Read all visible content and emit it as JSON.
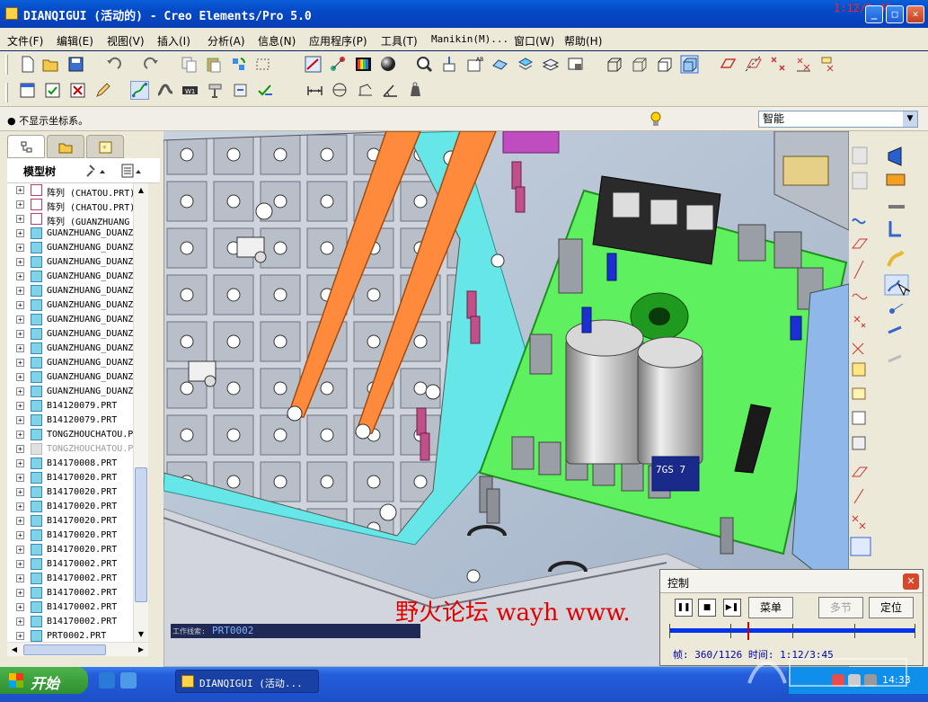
{
  "window": {
    "title": "DIANQIGUI (活动的) - Creo Elements/Pro 5.0",
    "timecode": "1:12/3:45"
  },
  "menu": [
    "文件(F)",
    "编辑(E)",
    "视图(V)",
    "插入(I)",
    "分析(A)",
    "信息(N)",
    "应用程序(P)",
    "工具(T)",
    "Manikin(M)...",
    "窗口(W)",
    "帮助(H)"
  ],
  "status": {
    "message": "● 不显示坐标系。",
    "filter_value": "智能"
  },
  "model_tree": {
    "title": "模型树",
    "items": [
      {
        "label": "阵列 (CHATOU.PRT)",
        "kind": "pattern"
      },
      {
        "label": "阵列 (CHATOU.PRT)",
        "kind": "pattern"
      },
      {
        "label": "阵列 (GUANZHUANG_",
        "kind": "pattern"
      },
      {
        "label": "GUANZHUANG_DUANZ",
        "kind": "part"
      },
      {
        "label": "GUANZHUANG_DUANZ",
        "kind": "part"
      },
      {
        "label": "GUANZHUANG_DUANZ",
        "kind": "part"
      },
      {
        "label": "GUANZHUANG_DUANZ",
        "kind": "part"
      },
      {
        "label": "GUANZHUANG_DUANZ",
        "kind": "part"
      },
      {
        "label": "GUANZHUANG_DUANZ",
        "kind": "part"
      },
      {
        "label": "GUANZHUANG_DUANZ",
        "kind": "part"
      },
      {
        "label": "GUANZHUANG_DUANZ",
        "kind": "part"
      },
      {
        "label": "GUANZHUANG_DUANZ",
        "kind": "part"
      },
      {
        "label": "GUANZHUANG_DUANZ",
        "kind": "part"
      },
      {
        "label": "GUANZHUANG_DUANZ",
        "kind": "part"
      },
      {
        "label": "GUANZHUANG_DUANZ",
        "kind": "part"
      },
      {
        "label": "B14120079.PRT",
        "kind": "part"
      },
      {
        "label": "B14120079.PRT",
        "kind": "part"
      },
      {
        "label": "TONGZHOUCHATOU.P",
        "kind": "part"
      },
      {
        "label": "TONGZHOUCHATOU.P",
        "kind": "dim"
      },
      {
        "label": "B14170008.PRT",
        "kind": "part"
      },
      {
        "label": "B14170020.PRT",
        "kind": "part"
      },
      {
        "label": "B14170020.PRT",
        "kind": "part"
      },
      {
        "label": "B14170020.PRT",
        "kind": "part"
      },
      {
        "label": "B14170020.PRT",
        "kind": "part"
      },
      {
        "label": "B14170020.PRT",
        "kind": "part"
      },
      {
        "label": "B14170020.PRT",
        "kind": "part"
      },
      {
        "label": "B14170002.PRT",
        "kind": "part"
      },
      {
        "label": "B14170002.PRT",
        "kind": "part"
      },
      {
        "label": "B14170002.PRT",
        "kind": "part"
      },
      {
        "label": "B14170002.PRT",
        "kind": "part"
      },
      {
        "label": "B14170002.PRT",
        "kind": "part"
      },
      {
        "label": "PRT0002.PRT",
        "kind": "ok"
      }
    ]
  },
  "viewport": {
    "watermark": "野火论坛 wayh www.",
    "work_label_key": "工作线索:",
    "work_label_value": "PRT0002",
    "pcb_label": "7GS 7"
  },
  "playback": {
    "title": "控制",
    "menu_button": "菜单",
    "multi_button": "多节",
    "locate_button": "定位",
    "frame_text": "帧: 360/1126 时间: 1:12/3:45",
    "progress": 0.32
  },
  "taskbar": {
    "start": "开始",
    "task": "DIANQIGUI (活动...",
    "clock": "14:33"
  },
  "colors": {
    "pcb": "#5ef05e",
    "bar": "#ff8a3c",
    "base": "#cfd4dc",
    "cyan": "#66e6e6",
    "watermark": "#e00000"
  }
}
